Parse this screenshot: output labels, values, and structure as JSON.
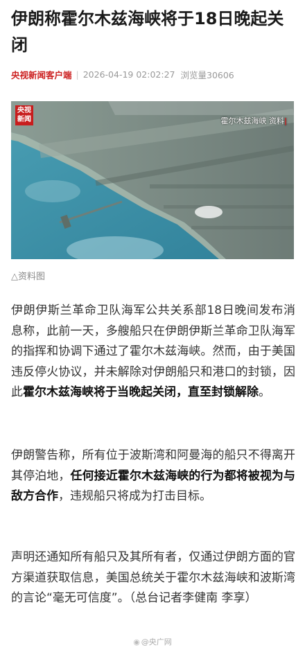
{
  "article": {
    "title": "伊朗称霍尔木兹海峡将于18日晚起关闭",
    "source": "央视新闻客户端",
    "date": "2026-04-19 02:02:27",
    "views": "浏览量30606"
  },
  "image": {
    "logo_top": "央视",
    "logo_bottom": "新闻",
    "overlay_text": "霍尔木兹海峡",
    "overlay_label": "资料",
    "caption": "△资料图"
  },
  "paragraphs": [
    {
      "p1_a": "伊朗伊斯兰革命卫队海军公共关系部18日晚间发布消息称，此前一天，多艘船只在伊朗伊斯兰革命卫队海军的指挥和协调下通过了霍尔木兹海峡。然而，由于美国违反停火协议，并未解除对伊朗船只和港口的封锁，因此",
      "p1_b": "霍尔木兹海峡将于当晚起关闭，直至封锁解除",
      "p1_c": "。"
    },
    {
      "p2_a": "伊朗警告称，所有位于波斯湾和阿曼海的船只不得离开其停泊地，",
      "p2_b": "任何接近霍尔木兹海峡的行为都将被视为与敌方合作",
      "p2_c": "，违规船只将成为打击目标。"
    },
    {
      "p3": "声明还通知所有船只及其所有者，仅通过伊朗方面的官方渠道获取信息，美国总统关于霍尔木兹海峡和波斯湾的言论“毫无可信度”。（总台记者李健南 李享）"
    }
  ],
  "footer": {
    "watermark": "@央广网"
  },
  "colors": {
    "source_red": "#cc1f1f",
    "sea": "#3d8ea6",
    "land": "#7a8a84"
  }
}
